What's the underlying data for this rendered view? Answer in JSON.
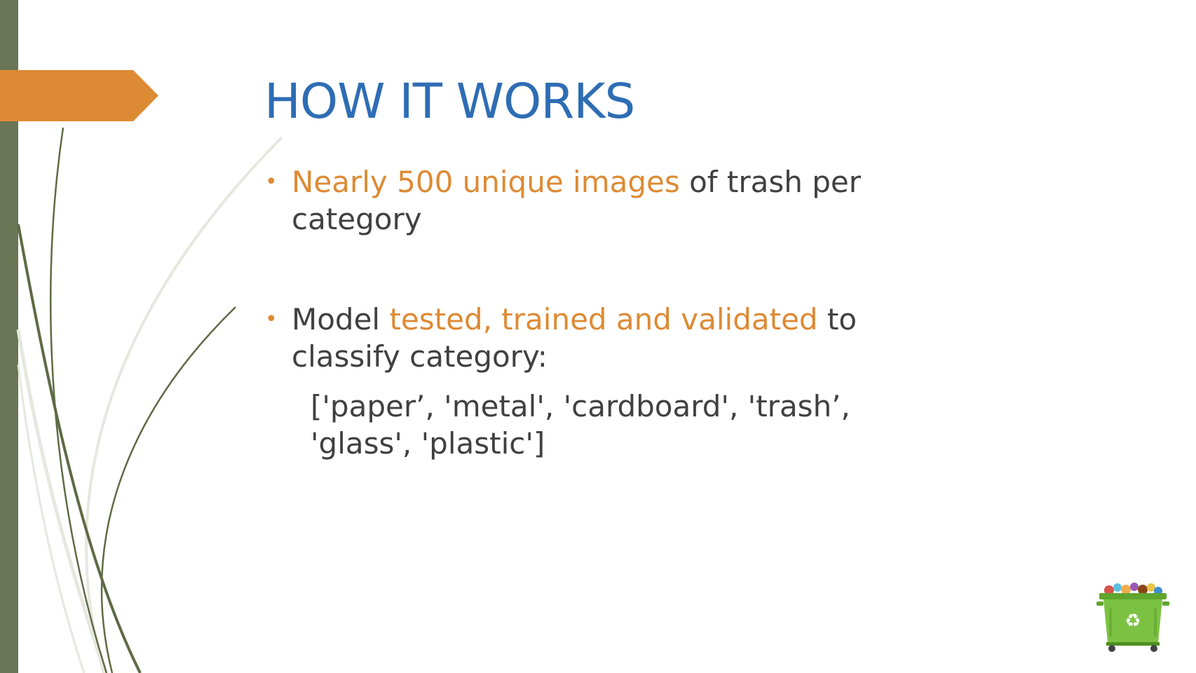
{
  "slide": {
    "title": "HOW IT WORKS",
    "bullets": [
      {
        "highlight": "Nearly 500 unique images",
        "rest": " of trash per category"
      },
      {
        "lead": "Model ",
        "highlight": "tested, trained and validated",
        "rest": " to classify category:"
      }
    ],
    "categories_list": "['paper’, 'metal', 'cardboard', 'trash’, 'glass', 'plastic']",
    "bullet_glyph": "•"
  },
  "decorations": {
    "left_bar": "vertical-bar",
    "tab": "arrow-tab",
    "grass": "grass-blades",
    "picture": "recycling-bin-icon",
    "picture_glyph": "♻"
  },
  "colors": {
    "title": "#2E6DB4",
    "body_text": "#404040",
    "accent": "#DD8A34",
    "left_bar": "#6A7556",
    "grass_dark": "#5E6B44",
    "grass_light": "#E5E8DF",
    "bin_green": "#7CC242"
  }
}
